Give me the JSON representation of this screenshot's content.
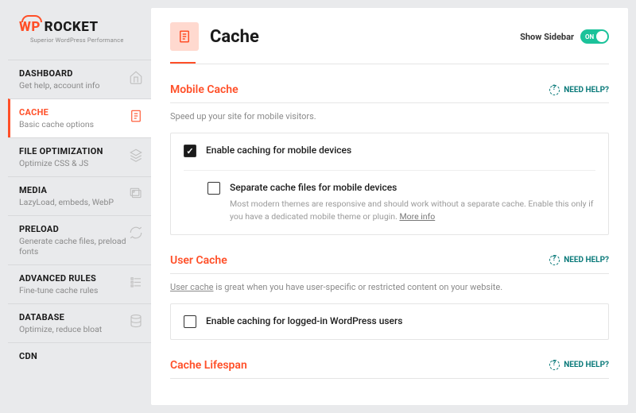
{
  "logo": {
    "wp": "WP",
    "rocket": "ROCKET",
    "tagline": "Superior WordPress Performance"
  },
  "nav": [
    {
      "title": "DASHBOARD",
      "desc": "Get help, account info",
      "icon": "home"
    },
    {
      "title": "CACHE",
      "desc": "Basic cache options",
      "icon": "file"
    },
    {
      "title": "FILE OPTIMIZATION",
      "desc": "Optimize CSS & JS",
      "icon": "layers"
    },
    {
      "title": "MEDIA",
      "desc": "LazyLoad, embeds, WebP",
      "icon": "images"
    },
    {
      "title": "PRELOAD",
      "desc": "Generate cache files, preload fonts",
      "icon": "refresh"
    },
    {
      "title": "ADVANCED RULES",
      "desc": "Fine-tune cache rules",
      "icon": "sliders"
    },
    {
      "title": "DATABASE",
      "desc": "Optimize, reduce bloat",
      "icon": "database"
    },
    {
      "title": "CDN",
      "desc": "",
      "icon": ""
    }
  ],
  "header": {
    "title": "Cache",
    "sidebarLabel": "Show Sidebar",
    "toggleOn": "ON"
  },
  "sections": {
    "mobile": {
      "title": "Mobile Cache",
      "help": "NEED HELP?",
      "desc": "Speed up your site for mobile visitors.",
      "opt1": "Enable caching for mobile devices",
      "opt2": "Separate cache files for mobile devices",
      "opt2desc": "Most modern themes are responsive and should work without a separate cache. Enable this only if you have a dedicated mobile theme or plugin. ",
      "moreInfo": "More info"
    },
    "user": {
      "title": "User Cache",
      "help": "NEED HELP?",
      "linkText": "User cache",
      "desc": " is great when you have user-specific or restricted content on your website.",
      "opt1": "Enable caching for logged-in WordPress users"
    },
    "lifespan": {
      "title": "Cache Lifespan",
      "help": "NEED HELP?"
    }
  }
}
